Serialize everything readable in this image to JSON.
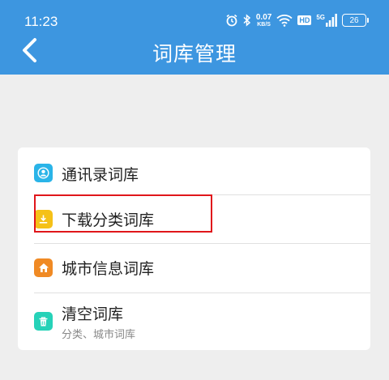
{
  "status_bar": {
    "time": "11:23",
    "net_speed_value": "0.07",
    "net_speed_unit": "KB/S",
    "hd": "HD",
    "signal_5g": "5G",
    "battery": "26"
  },
  "header": {
    "title": "词库管理",
    "background": "#3d96e0"
  },
  "items": [
    {
      "label": "通讯录词库",
      "icon": "contact-icon",
      "color": "#2ab4e8"
    },
    {
      "label": "下载分类词库",
      "icon": "download-icon",
      "color": "#f5c118"
    },
    {
      "label": "城市信息词库",
      "icon": "home-icon",
      "color": "#f08a24"
    },
    {
      "label": "清空词库",
      "subtitle": "分类、城市词库",
      "icon": "trash-icon",
      "color": "#26d2b8"
    }
  ],
  "highlight_color": "#e0161b"
}
